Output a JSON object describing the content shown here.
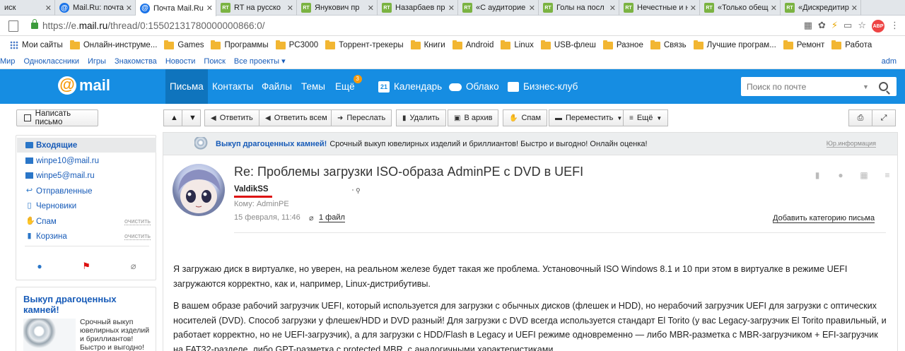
{
  "browser": {
    "tabs": [
      {
        "title": "иск",
        "favicon": "",
        "active": false
      },
      {
        "title": "Mail.Ru: почта",
        "favicon": "mail-at",
        "active": false
      },
      {
        "title": "Почта Mail.Ru",
        "favicon": "mail-at",
        "active": true
      },
      {
        "title": "RT на русско",
        "favicon": "rt",
        "active": false
      },
      {
        "title": "Янукович пр",
        "favicon": "rt",
        "active": false
      },
      {
        "title": "Назарбаев пр",
        "favicon": "rt",
        "active": false
      },
      {
        "title": "«С аудиторие",
        "favicon": "rt",
        "active": false
      },
      {
        "title": "Голы на посл",
        "favicon": "rt",
        "active": false
      },
      {
        "title": "Нечестные и н",
        "favicon": "rt",
        "active": false
      },
      {
        "title": "«Только обещ",
        "favicon": "rt",
        "active": false
      },
      {
        "title": "«Дискредитир",
        "favicon": "rt",
        "active": false
      }
    ],
    "url_prefix": "https://e.",
    "url_host": "mail.ru",
    "url_path": "/thread/0:15502131780000000866:0/",
    "bookmarks": [
      "Мои сайты",
      "Онлайн-инструме...",
      "Games",
      "Программы",
      "PC3000",
      "Торрент-трекеры",
      "Книги",
      "Android",
      "Linux",
      "USB-флеш",
      "Разное",
      "Связь",
      "Лучшие програм...",
      "Ремонт",
      "Работа"
    ],
    "portal_links": [
      "Мир",
      "Одноклассники",
      "Игры",
      "Знакомства",
      "Новости",
      "Поиск",
      "Все проекты ▾"
    ],
    "portal_right": "adm"
  },
  "mail": {
    "logo_text": "mail",
    "nav": [
      "Письма",
      "Контакты",
      "Файлы",
      "Темы",
      "Ещё"
    ],
    "nav_badge": "3",
    "services": [
      {
        "label": "Календарь",
        "icon": "calendar-icon",
        "day": "21"
      },
      {
        "label": "Облако",
        "icon": "cloud-icon"
      },
      {
        "label": "Бизнес-клуб",
        "icon": "business-icon"
      }
    ],
    "search_placeholder": "Поиск по почте",
    "compose_label": "Написать письмо",
    "toolbar": {
      "reply": "Ответить",
      "reply_all": "Ответить всем",
      "forward": "Переслать",
      "delete": "Удалить",
      "archive": "В архив",
      "spam": "Спам",
      "move": "Переместить",
      "more": "Ещё"
    }
  },
  "folders": [
    {
      "name": "Входящие",
      "active": true
    },
    {
      "name": "winpe10@mail.ru"
    },
    {
      "name": "winpe5@mail.ru"
    },
    {
      "name": "Отправленные"
    },
    {
      "name": "Черновики"
    },
    {
      "name": "Спам",
      "action": "очистить"
    },
    {
      "name": "Корзина",
      "action": "очистить"
    }
  ],
  "ad": {
    "title": "Выкуп драгоценных камней!",
    "text": "Срочный выкуп ювелирных изделий и бриллиантов! Быстро и выгодно!"
  },
  "banner": {
    "title": "Выкуп драгоценных камней!",
    "text": "Срочный выкуп ювелирных изделий и бриллиантов! Быстро и выгодно! Онлайн оценка!",
    "info": "Юр.информация"
  },
  "message": {
    "subject": "Re: Проблемы загрузки ISO-образа AdminPE с DVD в UEFI",
    "sender": "ValdikSS",
    "to": "Кому: AdminPE",
    "date": "15 февраля, 11:46",
    "attachments": "1 файл",
    "add_category": "Добавить категорию письма",
    "paragraphs": [
      "Я загружаю диск в виртуалке, но уверен, на реальном железе будет такая же проблема. Установочный ISO Windows 8.1 и 10 при этом в виртуалке в режиме UEFI загружаются корректно, как и, например, Linux-дистрибутивы.",
      "В вашем образе рабочий загрузчик UEFI, который используется для загрузки с обычных дисков (флешек и HDD), но нерабочий загрузчик UEFI для загрузки с оптических носителей (DVD). Способ загрузки у флешек/HDD и DVD разный! Для загрузки с DVD всегда используется стандарт El Torito (у вас Legacy-загрузчик El Torito правильный, и работает корректно, но не UEFI-загрузчик), а для загрузки с HDD/Flash в Legacy и UEFI режиме одновременно — либо MBR-разметка с MBR-загрузчиком + EFI-загрузчик на FAT32-разделе, либо GPT-разметка с protected MBR, с аналогичными характеристиками."
    ]
  },
  "colors": {
    "header_blue": "#168de2",
    "active_nav": "#0f74bd",
    "link_blue": "#175bb8",
    "badge_orange": "#f59a0c",
    "sender_underline": "#dd1111"
  }
}
